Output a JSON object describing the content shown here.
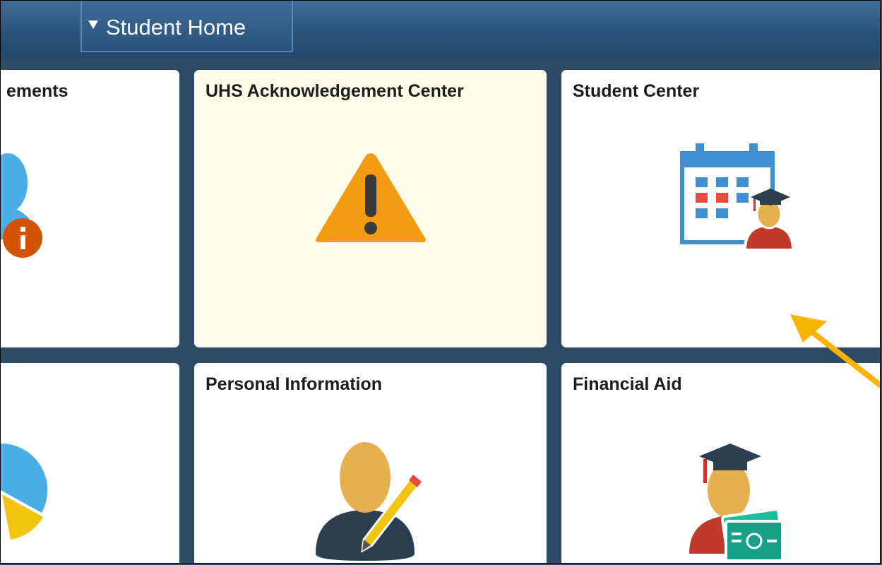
{
  "header": {
    "home_dropdown_label": "Student Home"
  },
  "tiles": [
    {
      "title": "ements"
    },
    {
      "title": "UHS Acknowledgement Center"
    },
    {
      "title": "Student Center"
    },
    {
      "title": ""
    },
    {
      "title": "Personal Information"
    },
    {
      "title": "Financial Aid"
    }
  ],
  "icons": {
    "tile0": "announcements-person-info-icon",
    "tile1": "warning-triangle-icon",
    "tile2": "calendar-graduate-icon",
    "tile3": "pie-chart-icon",
    "tile4": "person-pencil-icon",
    "tile5": "graduate-money-icon"
  },
  "colors": {
    "header": "#2a5278",
    "background": "#2d4b66",
    "tile_highlight": "#fefdeb",
    "warning": "#f39c12",
    "annotation_arrow": "#f7b500"
  }
}
